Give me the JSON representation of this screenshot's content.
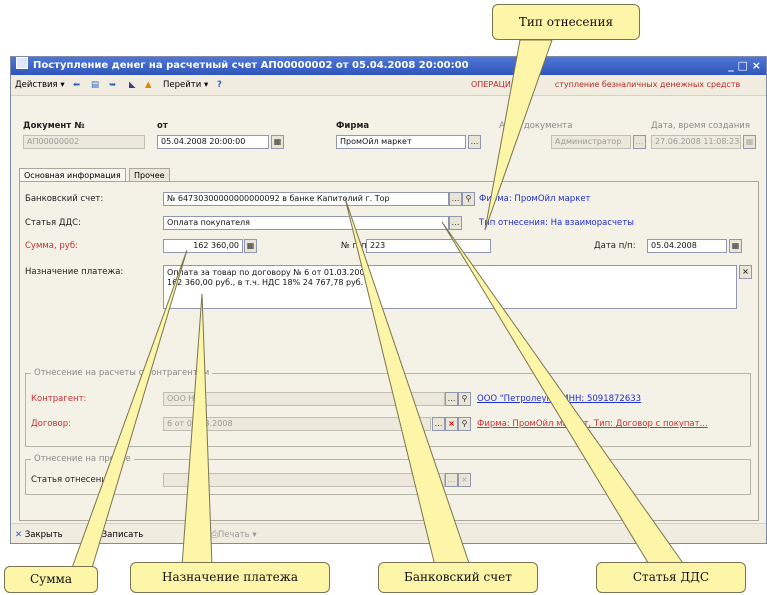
{
  "window": {
    "title": "Поступление денег на расчетный счет АП00000002 от 05.04.2008 20:00:00",
    "controls": "_ □ ×"
  },
  "toolbar": {
    "actions": "Действия",
    "goto": "Перейти",
    "help": "?",
    "operation_prefix": "ОПЕРАЦИ",
    "operation_rest": "ступление безналичных денежных средств"
  },
  "header": {
    "doc_no_label": "Документ №",
    "doc_no": "АП00000002",
    "from_label": "от",
    "from_date": "05.04.2008 20:00:00",
    "firm_label": "Фирма",
    "firm": "ПромОйл маркет",
    "author_label": "Ав",
    "author_label_rest": "документа",
    "author": "Администратор",
    "created_label": "Дата, время создания",
    "created": "27.06.2008 11:08:23"
  },
  "tabs": [
    "Основная информация",
    "Прочее"
  ],
  "main": {
    "bank_label": "Банковский счет:",
    "bank_value": "№ 64730300000000000092 в банке Капитолий г. Тор",
    "firm_link": "Фирма: ПромОйл маркет",
    "dds_label": "Статья ДДС:",
    "dds_value": "Оплата покупателя",
    "relation_link": "Тип отнесения: На взаиморасчеты",
    "sum_label": "Сумма, руб:",
    "sum_value": "162 360,00",
    "pp_label": "№ п/п:",
    "pp_value": "223",
    "date_pp_label": "Дата п/п:",
    "date_pp_value": "05.04.2008",
    "purpose_label": "Назначение платежа:",
    "purpose_line1": "Оплата за товар по договору № 6 от 01.03.2008.",
    "purpose_line2": "162 360,00 руб., в т.ч. НДС 18% 24 767,78 руб."
  },
  "group1": {
    "title": "Отнесение на расчеты с контрагентом",
    "contractor_label": "Контрагент:",
    "contractor_value": "ООО НП",
    "contract_label": "Договор:",
    "contract_value": "6 от 01.03.2008",
    "contractor_link": "ООО \"Петролеум\", ИНН: 5091872633",
    "contract_link": "Фирма: ПромОйл маркет, Тип: Договор с покупат..."
  },
  "group2": {
    "title": "Отнесение на прочие",
    "dds_label": "Статья отнесения:"
  },
  "bottom": {
    "close": "Закрыть",
    "save": "Записать",
    "print": "Печать"
  },
  "callouts": {
    "relation_type": "Тип отнесения",
    "sum": "Сумма",
    "purpose": "Назначение платежа",
    "bank": "Банковский счет",
    "dds": "Статья ДДС"
  }
}
